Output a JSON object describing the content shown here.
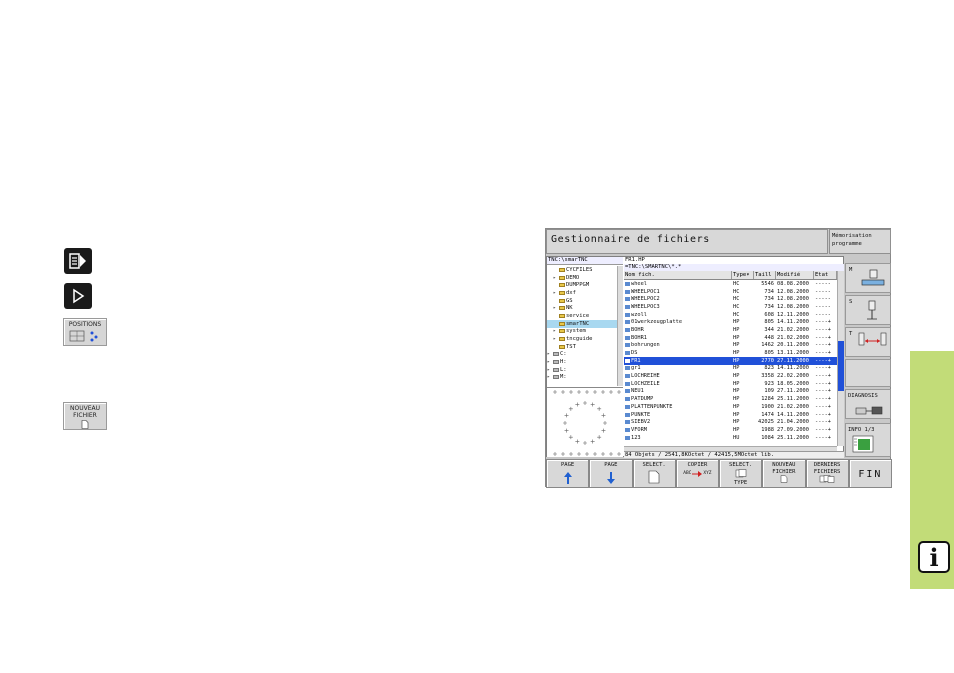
{
  "left_icons": {
    "positions_label": "POSITIONS",
    "nouveau_fichier_label_1": "NOUVEAU",
    "nouveau_fichier_label_2": "FICHIER"
  },
  "screen": {
    "title": "Gestionnaire de fichiers",
    "mode_line1": "Mémorisation",
    "mode_line2": "programme",
    "tree_header": "TNC:\\smarTNC",
    "tree": [
      {
        "label": "CYCFILES",
        "kind": "folder",
        "arrow": ""
      },
      {
        "label": "DEMO",
        "kind": "folder",
        "arrow": "▸"
      },
      {
        "label": "DUMPPGM",
        "kind": "folder",
        "arrow": ""
      },
      {
        "label": "dxf",
        "kind": "folder",
        "arrow": "▸"
      },
      {
        "label": "GS",
        "kind": "folder",
        "arrow": ""
      },
      {
        "label": "NK",
        "kind": "folder",
        "arrow": "▸"
      },
      {
        "label": "service",
        "kind": "folder",
        "arrow": ""
      },
      {
        "label": "smarTNC",
        "kind": "folder",
        "arrow": "",
        "selected": true
      },
      {
        "label": "system",
        "kind": "folder",
        "arrow": "▸"
      },
      {
        "label": "tncguide",
        "kind": "folder",
        "arrow": "▸"
      },
      {
        "label": "TST",
        "kind": "folder",
        "arrow": ""
      },
      {
        "label": "C:",
        "kind": "drive",
        "arrow": "▸"
      },
      {
        "label": "H:",
        "kind": "drive",
        "arrow": "▸"
      },
      {
        "label": "L:",
        "kind": "drive",
        "arrow": "▸"
      },
      {
        "label": "M:",
        "kind": "drive",
        "arrow": "▸"
      }
    ],
    "path_file": "FR1.HP",
    "path_filter": "=TNC:\\SMARTNC\\*.*",
    "columns": [
      "Nom fich.",
      "Type▾",
      "Taill",
      "Modifié",
      "Etat"
    ],
    "files": [
      {
        "name": "wheel",
        "type": "HC",
        "size": "5546",
        "date": "08.08.2000",
        "state": "-----"
      },
      {
        "name": "WHEELPOC1",
        "type": "HC",
        "size": "734",
        "date": "12.08.2000",
        "state": "-----"
      },
      {
        "name": "WHEELPOC2",
        "type": "HC",
        "size": "734",
        "date": "12.08.2000",
        "state": "-----"
      },
      {
        "name": "WHEELPOC3",
        "type": "HC",
        "size": "734",
        "date": "12.08.2000",
        "state": "-----"
      },
      {
        "name": "wzoll",
        "type": "HC",
        "size": "608",
        "date": "12.11.2000",
        "state": "-----"
      },
      {
        "name": "01werkzeugplatte",
        "type": "HP",
        "size": "805",
        "date": "14.11.2000",
        "state": "----+"
      },
      {
        "name": "BOHR",
        "type": "HP",
        "size": "344",
        "date": "21.02.2000",
        "state": "----+"
      },
      {
        "name": "BOHR1",
        "type": "HP",
        "size": "448",
        "date": "21.02.2000",
        "state": "----+"
      },
      {
        "name": "bohrungen",
        "type": "HP",
        "size": "1462",
        "date": "20.11.2000",
        "state": "----+"
      },
      {
        "name": "DS",
        "type": "HP",
        "size": "805",
        "date": "13.11.2000",
        "state": "----+"
      },
      {
        "name": "FR1",
        "type": "HP",
        "size": "2770",
        "date": "27.11.2000",
        "state": "----+",
        "selected": true
      },
      {
        "name": "gr1",
        "type": "HP",
        "size": "823",
        "date": "14.11.2000",
        "state": "----+"
      },
      {
        "name": "LOCHREIHE",
        "type": "HP",
        "size": "3358",
        "date": "22.02.2000",
        "state": "----+"
      },
      {
        "name": "LOCHZEILE",
        "type": "HP",
        "size": "923",
        "date": "18.05.2000",
        "state": "----+"
      },
      {
        "name": "NEU1",
        "type": "HP",
        "size": "109",
        "date": "27.11.2000",
        "state": "----+"
      },
      {
        "name": "PATDUMP",
        "type": "HP",
        "size": "1284",
        "date": "25.11.2000",
        "state": "----+"
      },
      {
        "name": "PLATTENPUNKTE",
        "type": "HP",
        "size": "1900",
        "date": "21.02.2000",
        "state": "----+"
      },
      {
        "name": "PUNKTE",
        "type": "HP",
        "size": "1474",
        "date": "14.11.2000",
        "state": "----+"
      },
      {
        "name": "SIEBV2",
        "type": "HP",
        "size": "42025",
        "date": "21.04.2000",
        "state": "----+"
      },
      {
        "name": "VFORM",
        "type": "HP",
        "size": "1988",
        "date": "27.09.2000",
        "state": "----+"
      },
      {
        "name": "123",
        "type": "HU",
        "size": "1084",
        "date": "25.11.2000",
        "state": "----+"
      }
    ],
    "status": "84 Objets / 2541,8KOctet / 42415,5MOctet lib.",
    "side_keys": {
      "m_label": "M",
      "s_label": "S",
      "t_label": "T",
      "diagnosis": "DIAGNOSIS",
      "info": "INFO 1/3"
    },
    "softkeys": [
      {
        "line1": "PAGE",
        "line2": "",
        "line3": ""
      },
      {
        "line1": "PAGE",
        "line2": "",
        "line3": ""
      },
      {
        "line1": "SELECT.",
        "line2": "",
        "line3": ""
      },
      {
        "line1": "COPIER",
        "line2": "ABC",
        "line3": "XYZ"
      },
      {
        "line1": "SELECT.",
        "line2": "",
        "line3": "TYPE"
      },
      {
        "line1": "NOUVEAU",
        "line2": "FICHIER",
        "line3": ""
      },
      {
        "line1": "DERNIERS",
        "line2": "FICHIERS",
        "line3": ""
      }
    ],
    "fin_label": "FIN"
  },
  "info_tab": {
    "icon": "i",
    "color": "#c2dc78"
  }
}
